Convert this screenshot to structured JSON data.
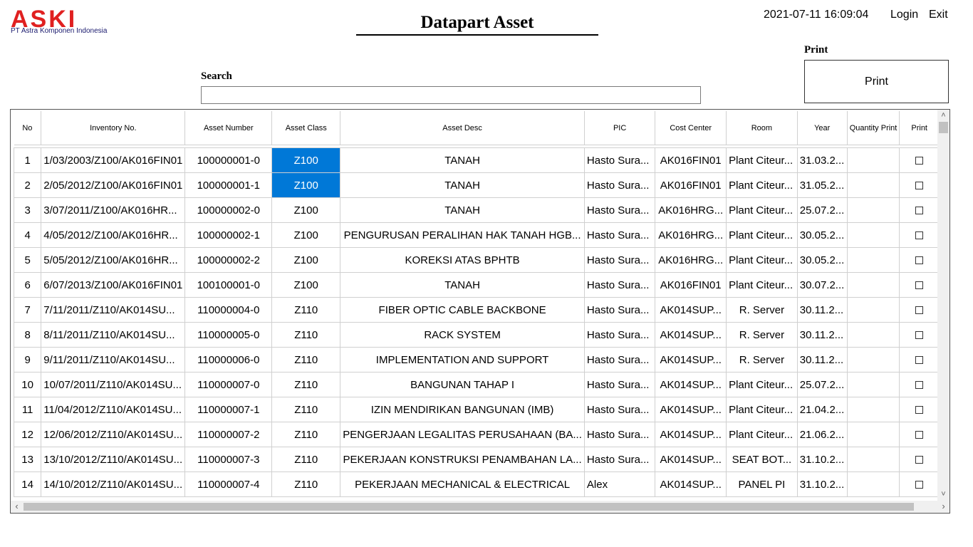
{
  "header": {
    "logo_text": "ASKI",
    "logo_subtitle": "PT Astra Komponen Indonesia",
    "title": "Datapart Asset",
    "datetime": "2021-07-11 16:09:04",
    "login_label": "Login",
    "exit_label": "Exit"
  },
  "print": {
    "section_label": "Print",
    "button_label": "Print"
  },
  "search": {
    "label": "Search",
    "value": ""
  },
  "colors": {
    "selected_cell": "#0078d7",
    "logo_red": "#e02020"
  },
  "table": {
    "columns": [
      "No",
      "Inventory No.",
      "Asset Number",
      "Asset Class",
      "Asset Desc",
      "PIC",
      "Cost Center",
      "Room",
      "Year",
      "Quantity Print",
      "Print"
    ],
    "rows": [
      {
        "no": "1",
        "inv": "1/03/2003/Z100/AK016FIN01",
        "asset": "100000001-0",
        "cls": "Z100",
        "desc": "TANAH",
        "pic": "Hasto Sura...",
        "cc": "AK016FIN01",
        "room": "Plant Citeur...",
        "year": "31.03.2...",
        "qty": "",
        "sel": true
      },
      {
        "no": "2",
        "inv": "2/05/2012/Z100/AK016FIN01",
        "asset": "100000001-1",
        "cls": "Z100",
        "desc": "TANAH",
        "pic": "Hasto Sura...",
        "cc": "AK016FIN01",
        "room": "Plant Citeur...",
        "year": "31.05.2...",
        "qty": "",
        "sel": true
      },
      {
        "no": "3",
        "inv": "3/07/2011/Z100/AK016HR...",
        "asset": "100000002-0",
        "cls": "Z100",
        "desc": "TANAH",
        "pic": "Hasto Sura...",
        "cc": "AK016HRG...",
        "room": "Plant Citeur...",
        "year": "25.07.2...",
        "qty": "",
        "sel": false
      },
      {
        "no": "4",
        "inv": "4/05/2012/Z100/AK016HR...",
        "asset": "100000002-1",
        "cls": "Z100",
        "desc": "PENGURUSAN PERALIHAN HAK TANAH HGB...",
        "pic": "Hasto Sura...",
        "cc": "AK016HRG...",
        "room": "Plant Citeur...",
        "year": "30.05.2...",
        "qty": "",
        "sel": false
      },
      {
        "no": "5",
        "inv": "5/05/2012/Z100/AK016HR...",
        "asset": "100000002-2",
        "cls": "Z100",
        "desc": "KOREKSI ATAS BPHTB",
        "pic": "Hasto Sura...",
        "cc": "AK016HRG...",
        "room": "Plant Citeur...",
        "year": "30.05.2...",
        "qty": "",
        "sel": false
      },
      {
        "no": "6",
        "inv": "6/07/2013/Z100/AK016FIN01",
        "asset": "100100001-0",
        "cls": "Z100",
        "desc": "TANAH",
        "pic": "Hasto Sura...",
        "cc": "AK016FIN01",
        "room": "Plant Citeur...",
        "year": "30.07.2...",
        "qty": "",
        "sel": false
      },
      {
        "no": "7",
        "inv": "7/11/2011/Z110/AK014SU...",
        "asset": "110000004-0",
        "cls": "Z110",
        "desc": "FIBER OPTIC CABLE BACKBONE",
        "pic": "Hasto Sura...",
        "cc": "AK014SUP...",
        "room": "R. Server",
        "year": "30.11.2...",
        "qty": "",
        "sel": false
      },
      {
        "no": "8",
        "inv": "8/11/2011/Z110/AK014SU...",
        "asset": "110000005-0",
        "cls": "Z110",
        "desc": "RACK SYSTEM",
        "pic": "Hasto Sura...",
        "cc": "AK014SUP...",
        "room": "R. Server",
        "year": "30.11.2...",
        "qty": "",
        "sel": false
      },
      {
        "no": "9",
        "inv": "9/11/2011/Z110/AK014SU...",
        "asset": "110000006-0",
        "cls": "Z110",
        "desc": "IMPLEMENTATION AND SUPPORT",
        "pic": "Hasto Sura...",
        "cc": "AK014SUP...",
        "room": "R. Server",
        "year": "30.11.2...",
        "qty": "",
        "sel": false
      },
      {
        "no": "10",
        "inv": "10/07/2011/Z110/AK014SU...",
        "asset": "110000007-0",
        "cls": "Z110",
        "desc": "BANGUNAN TAHAP I",
        "pic": "Hasto Sura...",
        "cc": "AK014SUP...",
        "room": "Plant Citeur...",
        "year": "25.07.2...",
        "qty": "",
        "sel": false
      },
      {
        "no": "11",
        "inv": "11/04/2012/Z110/AK014SU...",
        "asset": "110000007-1",
        "cls": "Z110",
        "desc": "IZIN MENDIRIKAN BANGUNAN (IMB)",
        "pic": "Hasto Sura...",
        "cc": "AK014SUP...",
        "room": "Plant Citeur...",
        "year": "21.04.2...",
        "qty": "",
        "sel": false
      },
      {
        "no": "12",
        "inv": "12/06/2012/Z110/AK014SU...",
        "asset": "110000007-2",
        "cls": "Z110",
        "desc": "PENGERJAAN LEGALITAS PERUSAHAAN (BA...",
        "pic": "Hasto Sura...",
        "cc": "AK014SUP...",
        "room": "Plant Citeur...",
        "year": "21.06.2...",
        "qty": "",
        "sel": false
      },
      {
        "no": "13",
        "inv": "13/10/2012/Z110/AK014SU...",
        "asset": "110000007-3",
        "cls": "Z110",
        "desc": "PEKERJAAN KONSTRUKSI PENAMBAHAN LA...",
        "pic": "Hasto Sura...",
        "cc": "AK014SUP...",
        "room": "SEAT BOT...",
        "year": "31.10.2...",
        "qty": "",
        "sel": false
      },
      {
        "no": "14",
        "inv": "14/10/2012/Z110/AK014SU...",
        "asset": "110000007-4",
        "cls": "Z110",
        "desc": "PEKERJAAN MECHANICAL & ELECTRICAL",
        "pic": "Alex",
        "cc": "AK014SUP...",
        "room": "PANEL PI",
        "year": "31.10.2...",
        "qty": "",
        "sel": false
      }
    ]
  }
}
